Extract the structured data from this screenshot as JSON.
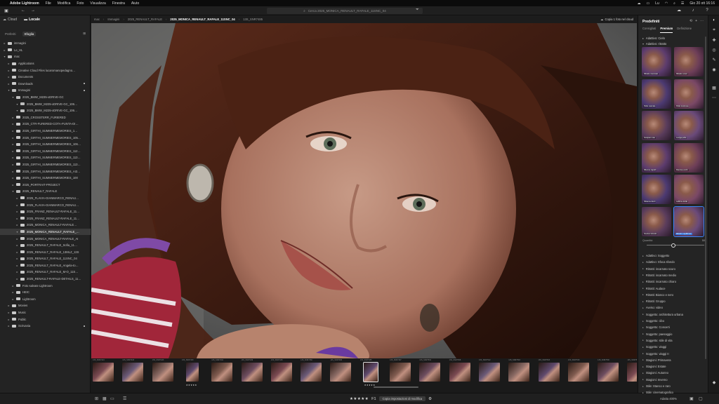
{
  "menubar": {
    "app": "Adobe Lightroom",
    "items": [
      "File",
      "Modifica",
      "Foto",
      "Visualizza",
      "Finestra",
      "Aiuto"
    ],
    "lang": "Lu",
    "clock": "Gio 20 ott  16:16"
  },
  "toolbar": {
    "search_placeholder": "Cerca 2025_MONICA_RENAULT_RAFALE_11SNC_04"
  },
  "left_panel": {
    "source_tabs": [
      "Cloud",
      "Locale"
    ],
    "active_source": "Locale",
    "sub_tabs": [
      "Preferiti",
      "Sfoglia"
    ],
    "active_sub": "Sfoglia",
    "tree": [
      {
        "label": "immagini",
        "indent": 0,
        "chev": "▸",
        "open": false
      },
      {
        "label": "Le_HL",
        "indent": 0,
        "chev": "▸",
        "open": false
      },
      {
        "label": "mac",
        "indent": 0,
        "chev": "▾",
        "open": true
      },
      {
        "label": "Applications",
        "indent": 1,
        "chev": "▸",
        "open": false
      },
      {
        "label": "Creative Cloud Files lucaromanopedagno…",
        "indent": 1,
        "chev": "▸",
        "open": false
      },
      {
        "label": "Documents",
        "indent": 1,
        "chev": "▸",
        "open": false
      },
      {
        "label": "Downloads",
        "indent": 1,
        "chev": "▸",
        "open": false,
        "dot": true
      },
      {
        "label": "Immagini",
        "indent": 1,
        "chev": "▾",
        "open": true,
        "dot": true
      },
      {
        "label": "2025_BMW_M235-xDRIVE-GC",
        "indent": 2,
        "chev": "▾",
        "open": true
      },
      {
        "label": "2025_BMW_M235-xDRIVE-GC_106…",
        "indent": 3,
        "chev": "▾",
        "open": true
      },
      {
        "label": "2025_BMW_M235-xDRIVE-GC_106…",
        "indent": 3,
        "chev": "▾",
        "open": true
      },
      {
        "label": "2025_CROSSTERR_FURIERED",
        "indent": 2,
        "chev": "▸",
        "open": false
      },
      {
        "label": "2025_CTR-FURERED-COTA-PUNTA-DI…",
        "indent": 2,
        "chev": "▸",
        "open": false
      },
      {
        "label": "2025_GIRTHI_SUMMERMEMORIES_1…",
        "indent": 2,
        "chev": "▸",
        "open": false
      },
      {
        "label": "2025_GIRTHI_SUMMERMEMORIES_105…",
        "indent": 2,
        "chev": "▸",
        "open": false
      },
      {
        "label": "2025_GIRTHI_SUMMERMEMORIES_106…",
        "indent": 2,
        "chev": "▸",
        "open": false
      },
      {
        "label": "2025_GIRTHI_SUMMERMEMORIES_112…",
        "indent": 2,
        "chev": "▸",
        "open": false
      },
      {
        "label": "2025_GIRTHI_SUMMERMEMORIES_113…",
        "indent": 2,
        "chev": "▸",
        "open": false
      },
      {
        "label": "2025_GIRTHI_SUMMERMEMORIES_113…",
        "indent": 2,
        "chev": "▸",
        "open": false
      },
      {
        "label": "2025_GIRTHI_SUMMERMEMORIES_AI3…",
        "indent": 2,
        "chev": "▸",
        "open": false
      },
      {
        "label": "2025_GIRTHI_SUMMERMEMORIES_100",
        "indent": 2,
        "chev": "▸",
        "open": false
      },
      {
        "label": "2025_PORTRAIT-PROJECT",
        "indent": 2,
        "chev": "▸",
        "open": false
      },
      {
        "label": "2025_RENAULT_RAFALE",
        "indent": 2,
        "chev": "▾",
        "open": true
      },
      {
        "label": "2025_FLAVIA-GIANMARCO_RENAU…",
        "indent": 3,
        "chev": "▸",
        "open": false
      },
      {
        "label": "2025_FLAVIA-GIANMARCO_RENAU…",
        "indent": 3,
        "chev": "▸",
        "open": false
      },
      {
        "label": "2025_FRANZ_RENAULT-RAFALE_11…",
        "indent": 3,
        "chev": "▸",
        "open": false
      },
      {
        "label": "2025_FRANZ_RENAULT-RAFALE_11…",
        "indent": 3,
        "chev": "▸",
        "open": false
      },
      {
        "label": "2025_MONICA_RENAULT-RAFALE…",
        "indent": 3,
        "chev": "▸",
        "open": false
      },
      {
        "label": "2025_MONICA_RENAULT_RAFALE_…",
        "indent": 3,
        "chev": "▾",
        "open": true,
        "selected": true
      },
      {
        "label": "2025_MONICA_RENAULT-RAFALE_AI",
        "indent": 3,
        "chev": "▸",
        "open": false
      },
      {
        "label": "2025_RENAULT_RAFALE_Sofia_11…",
        "indent": 3,
        "chev": "▸",
        "open": false
      },
      {
        "label": "2025_RENAULT_RAFALE_13MLZ_13S",
        "indent": 3,
        "chev": "▸",
        "open": false
      },
      {
        "label": "2025_RENAULT_RAFALE_11SNC_04",
        "indent": 3,
        "chev": "▸",
        "open": false
      },
      {
        "label": "2025_RENAULT_RAFALE_Angela-to…",
        "indent": 3,
        "chev": "▸",
        "open": false
      },
      {
        "label": "2025_RENAULT_RAFALE_M-O_11S…",
        "indent": 3,
        "chev": "▸",
        "open": false
      },
      {
        "label": "2025_RENAULT-RAFALE-DETAILS_11…",
        "indent": 3,
        "chev": "▸",
        "open": false
      },
      {
        "label": "Foto salvate Lightroom",
        "indent": 2,
        "chev": "▸",
        "open": false
      },
      {
        "label": "HEIC",
        "indent": 2,
        "chev": "▸",
        "open": false
      },
      {
        "label": "Lightroom",
        "indent": 2,
        "chev": "▸",
        "open": false
      },
      {
        "label": "Movies",
        "indent": 1,
        "chev": "▸",
        "open": false
      },
      {
        "label": "Music",
        "indent": 1,
        "chev": "▸",
        "open": false
      },
      {
        "label": "Public",
        "indent": 1,
        "chev": "▸",
        "open": false
      },
      {
        "label": "Scrivania",
        "indent": 1,
        "chev": "▸",
        "open": false,
        "dot": true
      }
    ]
  },
  "breadcrumb": {
    "items": [
      "mac",
      "Immagini",
      "2025_RENAULT_RAFALE",
      "2025_MONICA_RENAULT_RAFALE_11SNC_04",
      "13S_SNR7485"
    ],
    "current_index": 3,
    "copy_label": "Copia 1 foto nel cloud"
  },
  "filmstrip": {
    "thumbs": [
      {
        "name": "13S_SNR7413"
      },
      {
        "name": "13S_SNR7418"
      },
      {
        "name": "13S_SNR7423"
      },
      {
        "name": "13S_SNR7430",
        "stars": "★★★★★"
      },
      {
        "name": "13S_SNR7434"
      },
      {
        "name": "13S_SNR7439"
      },
      {
        "name": "13S_SNR7445"
      },
      {
        "name": "13S_SNR7450"
      },
      {
        "name": "13S_SNR7458"
      },
      {
        "name": "13S_SNR7485",
        "stars": "★★★★★",
        "selected": true
      },
      {
        "name": "13S_SNR7497"
      },
      {
        "name": "13S_SNR7502"
      },
      {
        "name": "13S_SNR7508"
      },
      {
        "name": "13S_SNR7512"
      },
      {
        "name": "13S_SNR7518"
      },
      {
        "name": "13S_SNR7523"
      },
      {
        "name": "13S_SNR7530"
      },
      {
        "name": "13S_SNR7536"
      },
      {
        "name": "13S_SNR7541"
      }
    ]
  },
  "bottombar": {
    "rating": "★★★★★",
    "flag_count": "F1",
    "copy_edit_label": "Copia impostazioni di modifica",
    "zoom_label": "Adatta  400%"
  },
  "right_panel": {
    "title": "Predefiniti",
    "tabs": [
      "Consigliati",
      "Premium",
      "Definizione"
    ],
    "active_tab": "Premium",
    "groups": [
      {
        "label": "Adattivo: Cielo",
        "chev": "▸"
      },
      {
        "label": "Adattivo: ritratto",
        "chev": "▾"
      }
    ],
    "presets": [
      "Ritratto ravvivato",
      "Ritratto scuro",
      "Pelle naturale",
      "Pelle luminosa",
      "Scolpisci viso",
      "Leviga pelle",
      "Ritocca capelli",
      "Ravviva occhi",
      "Sbianca denti",
      "Labbra vivide",
      "Scurisci sfondo",
      "Ritratto equilibrato"
    ],
    "selected_preset_index": 11,
    "amount_label": "Quantità",
    "amount_value": 50,
    "categories": [
      "Adattivo: Soggetto",
      "Adattivo: Sfoca sfondo",
      "Ritratti: incarnato scuro",
      "Ritratti: incarnato medio",
      "Ritratti: incarnato chiaro",
      "Ritratti: Audace",
      "Ritratti: Bianco e nero",
      "Ritratti: Gruppo",
      "Avviso: video",
      "Soggetto: architettura urbana",
      "Soggetto: cibo",
      "Soggetto: Concerti",
      "Soggetto: paesaggio",
      "Soggetto: stile di vita",
      "Soggetto: viaggi",
      "Soggetto: viaggi II",
      "Stagioni: Primavera",
      "Stagioni: Estate",
      "Stagioni: Autunno",
      "Stagioni: Inverno",
      "Stile: Stanco e raro",
      "Stile: cinematografico"
    ]
  },
  "colors": {
    "accent": "#2d6fd7",
    "panel": "#242424",
    "toolbar": "#1f1f1f"
  }
}
